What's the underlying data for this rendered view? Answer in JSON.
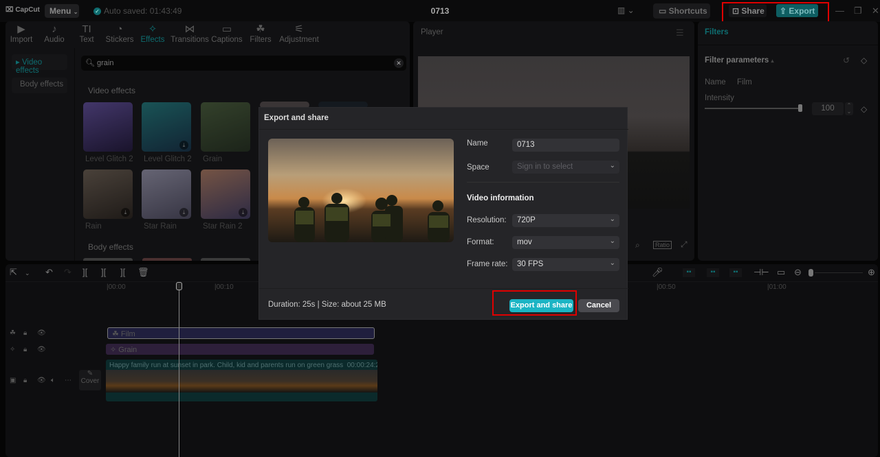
{
  "app": {
    "name": "CapCut",
    "menu_label": "Menu",
    "autosave": "Auto saved: 01:43:49",
    "project_title": "0713"
  },
  "topbar": {
    "shortcuts_label": "Shortcuts",
    "share_label": "Share",
    "export_label": "Export"
  },
  "toolbar": {
    "tabs": [
      {
        "label": "Import",
        "icon": "▶"
      },
      {
        "label": "Audio",
        "icon": "♪"
      },
      {
        "label": "Text",
        "icon": "TI"
      },
      {
        "label": "Stickers",
        "icon": "◔"
      },
      {
        "label": "Effects",
        "icon": "✧"
      },
      {
        "label": "Transitions",
        "icon": "⋈"
      },
      {
        "label": "Captions",
        "icon": "▭"
      },
      {
        "label": "Filters",
        "icon": "☘"
      },
      {
        "label": "Adjustment",
        "icon": "⚟"
      }
    ],
    "active": "Effects"
  },
  "sidebar": {
    "items": [
      {
        "label": "Video effects"
      },
      {
        "label": "Body effects"
      }
    ]
  },
  "search": {
    "value": "grain"
  },
  "effects": {
    "video_heading": "Video effects",
    "body_heading": "Body effects",
    "items": [
      {
        "label": "Level Glitch 2",
        "colors": [
          "#6f5bb0",
          "#2a2048"
        ],
        "download": false
      },
      {
        "label": "Level Glitch 2",
        "colors": [
          "#2a8a8e",
          "#1d3c56"
        ],
        "download": true
      },
      {
        "label": "Grain",
        "colors": [
          "#556b47",
          "#2e3b2a"
        ],
        "download": false
      },
      {
        "label": "Rain",
        "colors": [
          "#7a6c60",
          "#332c27"
        ],
        "download": true
      },
      {
        "label": "Star Rain",
        "colors": [
          "#a9a7c0",
          "#5b5870"
        ],
        "download": true
      },
      {
        "label": "Star Rain 2",
        "colors": [
          "#c28b72",
          "#4b4670"
        ],
        "download": true
      }
    ]
  },
  "player": {
    "title": "Player",
    "ratio_label": "Ratio"
  },
  "inspector": {
    "tab": "Filters",
    "section": "Filter parameters",
    "name_label": "Name",
    "name_value": "Film",
    "intensity_label": "Intensity",
    "intensity_value": "100",
    "intensity_fraction": 1.0
  },
  "dialog": {
    "title": "Export and share",
    "name_label": "Name",
    "name_value": "0713",
    "space_label": "Space",
    "space_placeholder": "Sign in to select",
    "video_info_heading": "Video information",
    "resolution_label": "Resolution:",
    "resolution_value": "720P",
    "format_label": "Format:",
    "format_value": "mov",
    "framerate_label": "Frame rate:",
    "framerate_value": "30 FPS",
    "summary": "Duration: 25s | Size: about 25 MB",
    "export_share_label": "Export and share",
    "cancel_label": "Cancel"
  },
  "timeline": {
    "ruler": [
      "00:00",
      "00:10",
      "00:50",
      "01:00"
    ],
    "cover_label": "Cover",
    "clips": {
      "film": "Film",
      "grain": "Grain",
      "video_title": "Happy family run at sunset in park. Child, kid and parents run on green grass",
      "video_duration": "00:00:24:2"
    }
  }
}
